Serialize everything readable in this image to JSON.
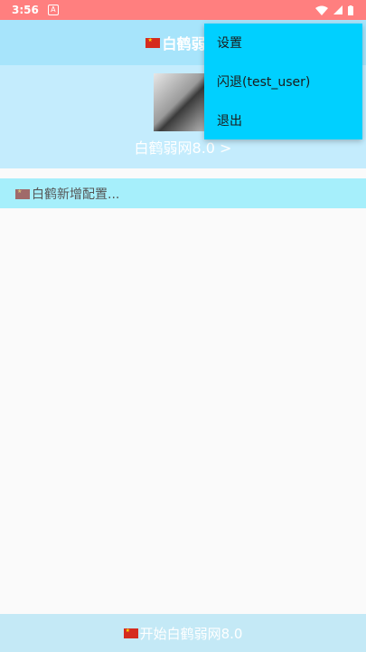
{
  "status_bar": {
    "time": "3:56"
  },
  "toolbar": {
    "title": "白鹤弱网"
  },
  "profile": {
    "name": "白鹤弱网8.0 >"
  },
  "config": {
    "text": "白鹤新增配置..."
  },
  "bottom": {
    "label": "开始白鹤弱网8.0"
  },
  "menu": {
    "items": [
      {
        "label": "设置"
      },
      {
        "label": "闪退(test_user)"
      },
      {
        "label": "退出"
      }
    ]
  },
  "colors": {
    "status_bar": "#ff7f7f",
    "toolbar": "#a7e4fb",
    "header": "#c4ecfd",
    "config_row": "#a6effb",
    "menu": "#00d0ff",
    "bottom_bar": "#c4e9f6"
  }
}
